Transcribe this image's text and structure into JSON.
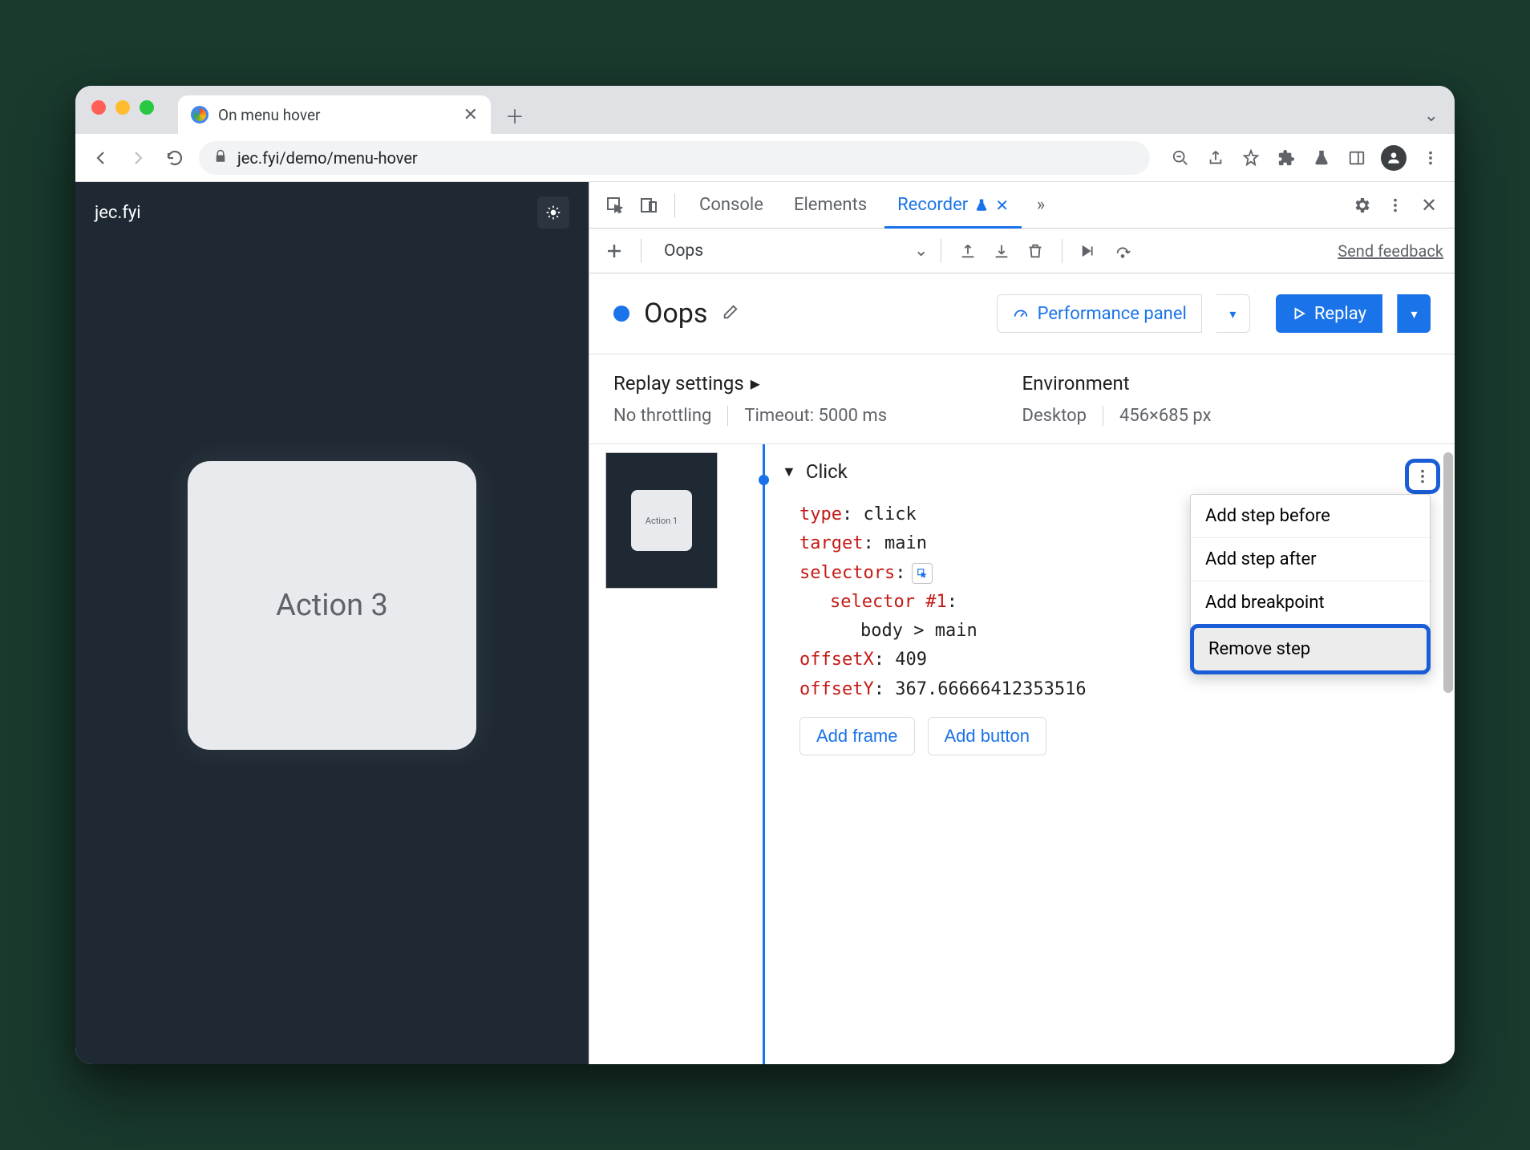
{
  "browser": {
    "tab_title": "On menu hover",
    "url": "jec.fyi/demo/menu-hover"
  },
  "page": {
    "site": "jec.fyi",
    "card": "Action 3"
  },
  "devtools": {
    "tabs": {
      "console": "Console",
      "elements": "Elements",
      "recorder": "Recorder"
    },
    "toolbar": {
      "recording_name": "Oops",
      "feedback": "Send feedback"
    },
    "title": {
      "name": "Oops",
      "perf_panel": "Performance panel",
      "replay": "Replay"
    },
    "settings": {
      "replay_h": "Replay settings",
      "throttling": "No throttling",
      "timeout": "Timeout: 5000 ms",
      "env_h": "Environment",
      "device": "Desktop",
      "viewport": "456×685 px"
    },
    "thumb_label": "Action 1",
    "step": {
      "title": "Click",
      "type_k": "type",
      "type_v": ": click",
      "target_k": "target",
      "target_v": ": main",
      "selectors_k": "selectors",
      "selectors_v": ":",
      "selnum_k": "selector #1",
      "selnum_v": ":",
      "selpath": "body > main",
      "ox_k": "offsetX",
      "ox_v": ": 409",
      "oy_k": "offsetY",
      "oy_v": ": 367.66666412353516",
      "add_frame": "Add frame",
      "add_button": "Add button"
    },
    "menu": {
      "before": "Add step before",
      "after": "Add step after",
      "bp": "Add breakpoint",
      "remove": "Remove step"
    }
  }
}
